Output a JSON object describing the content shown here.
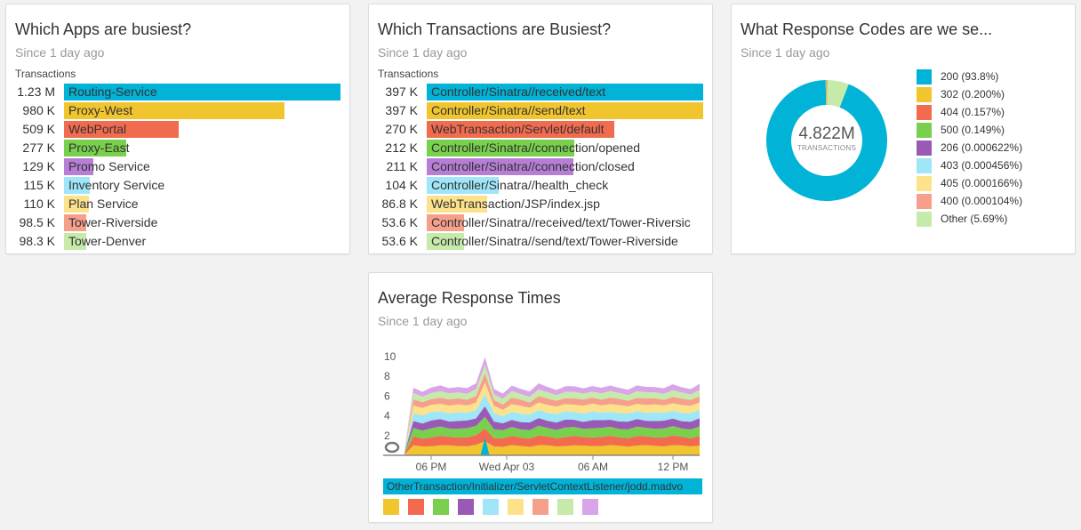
{
  "apps": {
    "title": "Which Apps are busiest?",
    "subtitle": "Since 1 day ago",
    "axis_label": "Transactions",
    "rows": [
      {
        "value": "1.23 M",
        "name": "Routing-Service",
        "fraction": 1.0,
        "color": "#00b3d7"
      },
      {
        "value": "980 K",
        "name": "Proxy-West",
        "fraction": 0.797,
        "color": "#f1c52e"
      },
      {
        "value": "509 K",
        "name": "WebPortal",
        "fraction": 0.414,
        "color": "#f26b4f"
      },
      {
        "value": "277 K",
        "name": "Proxy-East",
        "fraction": 0.225,
        "color": "#78d04c"
      },
      {
        "value": "129 K",
        "name": "Promo Service",
        "fraction": 0.105,
        "color": "#b67ed5"
      },
      {
        "value": "115 K",
        "name": "Inventory Service",
        "fraction": 0.094,
        "color": "#9ee6f8"
      },
      {
        "value": "110 K",
        "name": "Plan Service",
        "fraction": 0.089,
        "color": "#fde28c"
      },
      {
        "value": "98.5 K",
        "name": "Tower-Riverside",
        "fraction": 0.08,
        "color": "#f6a08c"
      },
      {
        "value": "98.3 K",
        "name": "Tower-Denver",
        "fraction": 0.08,
        "color": "#c5eaaa"
      }
    ]
  },
  "transactions": {
    "title": "Which Transactions are Busiest?",
    "subtitle": "Since 1 day ago",
    "axis_label": "Transactions",
    "rows": [
      {
        "value": "397 K",
        "name": "Controller/Sinatra//received/text",
        "fraction": 1.0,
        "color": "#00b3d7"
      },
      {
        "value": "397 K",
        "name": "Controller/Sinatra//send/text",
        "fraction": 1.0,
        "color": "#f1c52e"
      },
      {
        "value": "270 K",
        "name": "WebTransaction/Servlet/default",
        "fraction": 0.68,
        "color": "#f26b4f"
      },
      {
        "value": "212 K",
        "name": "Controller/Sinatra//connection/opened",
        "fraction": 0.534,
        "color": "#78d04c"
      },
      {
        "value": "211 K",
        "name": "Controller/Sinatra//connection/closed",
        "fraction": 0.531,
        "color": "#b67ed5"
      },
      {
        "value": "104 K",
        "name": "Controller/Sinatra//health_check",
        "fraction": 0.262,
        "color": "#9ee6f8"
      },
      {
        "value": "86.8 K",
        "name": "WebTransaction/JSP/index.jsp",
        "fraction": 0.219,
        "color": "#fde28c"
      },
      {
        "value": "53.6 K",
        "name": "Controller/Sinatra//received/text/Tower-Riversic",
        "fraction": 0.135,
        "color": "#f6a08c"
      },
      {
        "value": "53.6 K",
        "name": "Controller/Sinatra//send/text/Tower-Riverside",
        "fraction": 0.135,
        "color": "#c5eaaa"
      }
    ]
  },
  "codes": {
    "title": "What Response Codes are we se...",
    "subtitle": "Since 1 day ago",
    "total": "4.822M",
    "total_label": "TRANSACTIONS",
    "legend": [
      {
        "label": "200 (93.8%)",
        "pct": 93.8,
        "color": "#00b3d7"
      },
      {
        "label": "302 (0.200%)",
        "pct": 0.2,
        "color": "#f1c52e"
      },
      {
        "label": "404 (0.157%)",
        "pct": 0.157,
        "color": "#f26b4f"
      },
      {
        "label": "500 (0.149%)",
        "pct": 0.149,
        "color": "#78d04c"
      },
      {
        "label": "206 (0.000622%)",
        "pct": 0.000622,
        "color": "#9b59b6"
      },
      {
        "label": "403 (0.000456%)",
        "pct": 0.000456,
        "color": "#9ee6f8"
      },
      {
        "label": "405 (0.000166%)",
        "pct": 0.000166,
        "color": "#fde28c"
      },
      {
        "label": "400 (0.000104%)",
        "pct": 0.000104,
        "color": "#f6a08c"
      },
      {
        "label": "Other (5.69%)",
        "pct": 5.69,
        "color": "#c5eaaa"
      }
    ]
  },
  "response": {
    "title": "Average Response Times",
    "subtitle": "Since 1 day ago",
    "y_ticks": [
      "10",
      "8",
      "6",
      "4",
      "2"
    ],
    "x_ticks": [
      "06 PM",
      "Wed Apr 03",
      "06 AM",
      "12 PM"
    ],
    "tooltip": "OtherTransaction/Initializer/ServletContextListener/jodd.madvo",
    "swatches": [
      "#f1c52e",
      "#f26b4f",
      "#78d04c",
      "#9b59b6",
      "#9ee6f8",
      "#fde28c",
      "#f6a08c",
      "#c5eaaa",
      "#d9a4e8"
    ]
  },
  "chart_data": {
    "type": "area",
    "title": "Average Response Times",
    "ylim": [
      0,
      10
    ],
    "x_ticks": [
      "06 PM",
      "Wed Apr 03",
      "06 AM",
      "12 PM"
    ],
    "stack_totals_approx": [
      0.5,
      6.8,
      6.5,
      6.9,
      7.0,
      6.8,
      7.0,
      6.8,
      7.2,
      10.0,
      6.8,
      6.2,
      7.0,
      6.8,
      6.5,
      7.2,
      6.9,
      6.7,
      7.0,
      6.9,
      6.8,
      7.1,
      6.8,
      7.0,
      6.9,
      6.7,
      7.0,
      6.9,
      7.0,
      6.8,
      7.1,
      6.9,
      6.8,
      7.2
    ],
    "series_colors": [
      "#f1c52e",
      "#f26b4f",
      "#78d04c",
      "#9b59b6",
      "#9ee6f8",
      "#fde28c",
      "#f6a08c",
      "#c5eaaa",
      "#d9a4e8"
    ]
  }
}
